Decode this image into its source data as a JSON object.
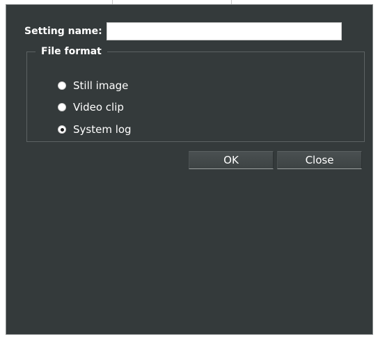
{
  "form": {
    "setting_name_label": "Setting name:",
    "setting_name_value": "",
    "file_format_legend": "File format",
    "options": [
      {
        "label": "Still image",
        "checked": false
      },
      {
        "label": "Video clip",
        "checked": false
      },
      {
        "label": "System log",
        "checked": true
      }
    ]
  },
  "buttons": {
    "ok": "OK",
    "close": "Close"
  },
  "colors": {
    "dialog_bg": "#343a3b",
    "text": "#ffffff",
    "border": "#5d6364"
  }
}
